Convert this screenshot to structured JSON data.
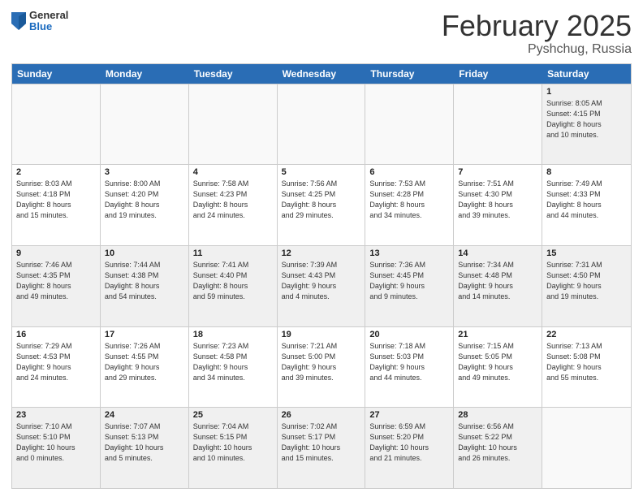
{
  "header": {
    "logo": {
      "line1": "General",
      "line2": "Blue"
    },
    "title": "February 2025",
    "subtitle": "Pyshchug, Russia"
  },
  "weekdays": [
    "Sunday",
    "Monday",
    "Tuesday",
    "Wednesday",
    "Thursday",
    "Friday",
    "Saturday"
  ],
  "weeks": [
    [
      {
        "day": "",
        "info": "",
        "empty": true
      },
      {
        "day": "",
        "info": "",
        "empty": true
      },
      {
        "day": "",
        "info": "",
        "empty": true
      },
      {
        "day": "",
        "info": "",
        "empty": true
      },
      {
        "day": "",
        "info": "",
        "empty": true
      },
      {
        "day": "",
        "info": "",
        "empty": true
      },
      {
        "day": "1",
        "info": "Sunrise: 8:05 AM\nSunset: 4:15 PM\nDaylight: 8 hours\nand 10 minutes."
      }
    ],
    [
      {
        "day": "2",
        "info": "Sunrise: 8:03 AM\nSunset: 4:18 PM\nDaylight: 8 hours\nand 15 minutes."
      },
      {
        "day": "3",
        "info": "Sunrise: 8:00 AM\nSunset: 4:20 PM\nDaylight: 8 hours\nand 19 minutes."
      },
      {
        "day": "4",
        "info": "Sunrise: 7:58 AM\nSunset: 4:23 PM\nDaylight: 8 hours\nand 24 minutes."
      },
      {
        "day": "5",
        "info": "Sunrise: 7:56 AM\nSunset: 4:25 PM\nDaylight: 8 hours\nand 29 minutes."
      },
      {
        "day": "6",
        "info": "Sunrise: 7:53 AM\nSunset: 4:28 PM\nDaylight: 8 hours\nand 34 minutes."
      },
      {
        "day": "7",
        "info": "Sunrise: 7:51 AM\nSunset: 4:30 PM\nDaylight: 8 hours\nand 39 minutes."
      },
      {
        "day": "8",
        "info": "Sunrise: 7:49 AM\nSunset: 4:33 PM\nDaylight: 8 hours\nand 44 minutes."
      }
    ],
    [
      {
        "day": "9",
        "info": "Sunrise: 7:46 AM\nSunset: 4:35 PM\nDaylight: 8 hours\nand 49 minutes."
      },
      {
        "day": "10",
        "info": "Sunrise: 7:44 AM\nSunset: 4:38 PM\nDaylight: 8 hours\nand 54 minutes."
      },
      {
        "day": "11",
        "info": "Sunrise: 7:41 AM\nSunset: 4:40 PM\nDaylight: 8 hours\nand 59 minutes."
      },
      {
        "day": "12",
        "info": "Sunrise: 7:39 AM\nSunset: 4:43 PM\nDaylight: 9 hours\nand 4 minutes."
      },
      {
        "day": "13",
        "info": "Sunrise: 7:36 AM\nSunset: 4:45 PM\nDaylight: 9 hours\nand 9 minutes."
      },
      {
        "day": "14",
        "info": "Sunrise: 7:34 AM\nSunset: 4:48 PM\nDaylight: 9 hours\nand 14 minutes."
      },
      {
        "day": "15",
        "info": "Sunrise: 7:31 AM\nSunset: 4:50 PM\nDaylight: 9 hours\nand 19 minutes."
      }
    ],
    [
      {
        "day": "16",
        "info": "Sunrise: 7:29 AM\nSunset: 4:53 PM\nDaylight: 9 hours\nand 24 minutes."
      },
      {
        "day": "17",
        "info": "Sunrise: 7:26 AM\nSunset: 4:55 PM\nDaylight: 9 hours\nand 29 minutes."
      },
      {
        "day": "18",
        "info": "Sunrise: 7:23 AM\nSunset: 4:58 PM\nDaylight: 9 hours\nand 34 minutes."
      },
      {
        "day": "19",
        "info": "Sunrise: 7:21 AM\nSunset: 5:00 PM\nDaylight: 9 hours\nand 39 minutes."
      },
      {
        "day": "20",
        "info": "Sunrise: 7:18 AM\nSunset: 5:03 PM\nDaylight: 9 hours\nand 44 minutes."
      },
      {
        "day": "21",
        "info": "Sunrise: 7:15 AM\nSunset: 5:05 PM\nDaylight: 9 hours\nand 49 minutes."
      },
      {
        "day": "22",
        "info": "Sunrise: 7:13 AM\nSunset: 5:08 PM\nDaylight: 9 hours\nand 55 minutes."
      }
    ],
    [
      {
        "day": "23",
        "info": "Sunrise: 7:10 AM\nSunset: 5:10 PM\nDaylight: 10 hours\nand 0 minutes."
      },
      {
        "day": "24",
        "info": "Sunrise: 7:07 AM\nSunset: 5:13 PM\nDaylight: 10 hours\nand 5 minutes."
      },
      {
        "day": "25",
        "info": "Sunrise: 7:04 AM\nSunset: 5:15 PM\nDaylight: 10 hours\nand 10 minutes."
      },
      {
        "day": "26",
        "info": "Sunrise: 7:02 AM\nSunset: 5:17 PM\nDaylight: 10 hours\nand 15 minutes."
      },
      {
        "day": "27",
        "info": "Sunrise: 6:59 AM\nSunset: 5:20 PM\nDaylight: 10 hours\nand 21 minutes."
      },
      {
        "day": "28",
        "info": "Sunrise: 6:56 AM\nSunset: 5:22 PM\nDaylight: 10 hours\nand 26 minutes."
      },
      {
        "day": "",
        "info": "",
        "empty": true
      }
    ]
  ]
}
